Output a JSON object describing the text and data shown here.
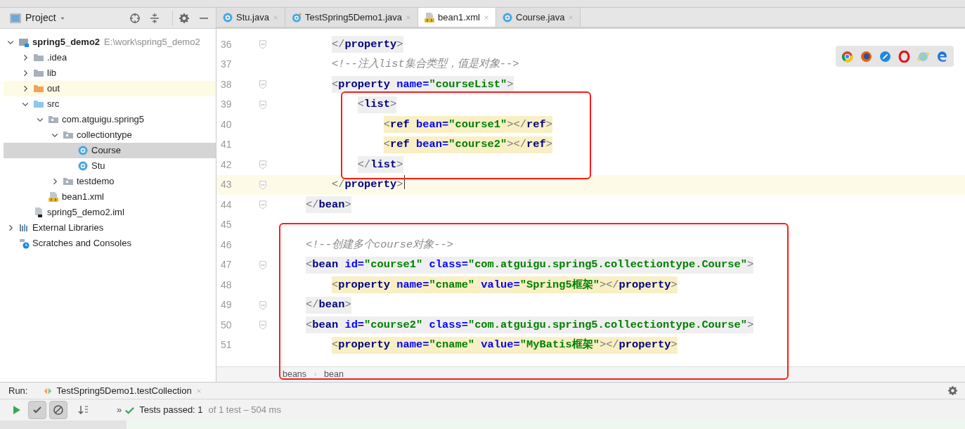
{
  "project_panel": {
    "title": "Project",
    "tree": [
      {
        "label": "spring5_demo2",
        "path": "E:\\work\\spring5_demo2",
        "kind": "module",
        "expanded": true,
        "selected": false,
        "highlighted": false,
        "children": [
          {
            "label": ".idea",
            "kind": "folder",
            "expanded": false,
            "selected": false,
            "highlighted": false
          },
          {
            "label": "lib",
            "kind": "folder",
            "expanded": false,
            "selected": false,
            "highlighted": false
          },
          {
            "label": "out",
            "kind": "excluded",
            "expanded": false,
            "selected": false,
            "highlighted": true
          },
          {
            "label": "src",
            "kind": "source",
            "expanded": true,
            "selected": false,
            "highlighted": false,
            "children": [
              {
                "label": "com.atguigu.spring5",
                "kind": "package",
                "expanded": true,
                "selected": false,
                "highlighted": false,
                "children": [
                  {
                    "label": "collectiontype",
                    "kind": "package",
                    "expanded": true,
                    "selected": false,
                    "highlighted": false,
                    "children": [
                      {
                        "label": "Course",
                        "kind": "class",
                        "selected": true,
                        "highlighted": false
                      },
                      {
                        "label": "Stu",
                        "kind": "class",
                        "selected": false,
                        "highlighted": false
                      }
                    ]
                  },
                  {
                    "label": "testdemo",
                    "kind": "package",
                    "expanded": false,
                    "selected": false,
                    "highlighted": false
                  }
                ]
              },
              {
                "label": "bean1.xml",
                "kind": "xml",
                "selected": false,
                "highlighted": false
              }
            ]
          },
          {
            "label": "spring5_demo2.iml",
            "kind": "iml",
            "selected": false,
            "highlighted": false
          }
        ]
      },
      {
        "label": "External Libraries",
        "kind": "libraries",
        "expanded": false,
        "selected": false,
        "highlighted": false
      },
      {
        "label": "Scratches and Consoles",
        "kind": "scratches",
        "selected": false,
        "highlighted": false
      }
    ]
  },
  "tabs": [
    {
      "label": "Stu.java",
      "kind": "class",
      "selected": false
    },
    {
      "label": "TestSpring5Demo1.java",
      "kind": "test",
      "selected": false
    },
    {
      "label": "bean1.xml",
      "kind": "xml",
      "selected": true
    },
    {
      "label": "Course.java",
      "kind": "class",
      "selected": false
    }
  ],
  "editor": {
    "lines": [
      {
        "number": "36",
        "fold": true,
        "current": false,
        "color": "#efefef",
        "tokens": [
          {
            "text": "        </",
            "kind": "bracket"
          },
          {
            "text": "property",
            "kind": "tag"
          },
          {
            "text": ">",
            "kind": "bracket"
          }
        ]
      },
      {
        "number": "37",
        "fold": false,
        "current": false,
        "tokens": [
          {
            "text": "        <!--注入list集合类型，值是对象-->",
            "kind": "comment"
          }
        ]
      },
      {
        "number": "38",
        "fold": true,
        "current": false,
        "color": "#efefef",
        "tokens": [
          {
            "text": "        <",
            "kind": "bracket"
          },
          {
            "text": "property ",
            "kind": "tag"
          },
          {
            "text": "name=",
            "kind": "attr"
          },
          {
            "text": "\"courseList\"",
            "kind": "value"
          },
          {
            "text": ">",
            "kind": "bracket"
          }
        ]
      },
      {
        "number": "39",
        "fold": true,
        "current": false,
        "color": "#efefef",
        "tokens": [
          {
            "text": "            <",
            "kind": "bracket"
          },
          {
            "text": "list",
            "kind": "tag"
          },
          {
            "text": ">",
            "kind": "bracket"
          }
        ]
      },
      {
        "number": "40",
        "fold": false,
        "current": false,
        "color": "#f8efc4",
        "tokens": [
          {
            "text": "                <",
            "kind": "bracket"
          },
          {
            "text": "ref ",
            "kind": "tag"
          },
          {
            "text": "bean=",
            "kind": "attr"
          },
          {
            "text": "\"course1\"",
            "kind": "value"
          },
          {
            "text": "></",
            "kind": "bracket"
          },
          {
            "text": "ref",
            "kind": "tag"
          },
          {
            "text": ">",
            "kind": "bracket"
          }
        ]
      },
      {
        "number": "41",
        "fold": false,
        "current": false,
        "color": "#f8efc4",
        "tokens": [
          {
            "text": "                <",
            "kind": "bracket"
          },
          {
            "text": "ref ",
            "kind": "tag"
          },
          {
            "text": "bean=",
            "kind": "attr"
          },
          {
            "text": "\"course2\"",
            "kind": "value"
          },
          {
            "text": "></",
            "kind": "bracket"
          },
          {
            "text": "ref",
            "kind": "tag"
          },
          {
            "text": ">",
            "kind": "bracket"
          }
        ]
      },
      {
        "number": "42",
        "fold": true,
        "current": false,
        "color": "#efefef",
        "tokens": [
          {
            "text": "            </",
            "kind": "bracket"
          },
          {
            "text": "list",
            "kind": "tag"
          },
          {
            "text": ">",
            "kind": "bracket"
          }
        ]
      },
      {
        "number": "43",
        "fold": true,
        "current": true,
        "tokens": [
          {
            "text": "        </",
            "kind": "bracket"
          },
          {
            "text": "property",
            "kind": "tag"
          },
          {
            "text": ">",
            "kind": "bracket"
          }
        ]
      },
      {
        "number": "44",
        "fold": true,
        "current": false,
        "color": "#efefef",
        "tokens": [
          {
            "text": "    </",
            "kind": "bracket"
          },
          {
            "text": "bean",
            "kind": "tag"
          },
          {
            "text": ">",
            "kind": "bracket"
          }
        ]
      },
      {
        "number": "45",
        "fold": false,
        "current": false
      },
      {
        "number": "46",
        "fold": false,
        "current": false,
        "tokens": [
          {
            "text": "    <!--创建多个course对象-->",
            "kind": "comment"
          }
        ]
      },
      {
        "number": "47",
        "fold": true,
        "current": false,
        "color": "#efefef",
        "tokens": [
          {
            "text": "    <",
            "kind": "bracket"
          },
          {
            "text": "bean ",
            "kind": "tag"
          },
          {
            "text": "id=",
            "kind": "attr"
          },
          {
            "text": "\"course1\" ",
            "kind": "value"
          },
          {
            "text": "class=",
            "kind": "attr"
          },
          {
            "text": "\"com.atguigu.spring5.collectiontype.Course\"",
            "kind": "value"
          },
          {
            "text": ">",
            "kind": "bracket"
          }
        ]
      },
      {
        "number": "48",
        "fold": false,
        "current": false,
        "color": "#f8efc4",
        "tokens": [
          {
            "text": "        <",
            "kind": "bracket"
          },
          {
            "text": "property ",
            "kind": "tag"
          },
          {
            "text": "name=",
            "kind": "attr"
          },
          {
            "text": "\"cname\" ",
            "kind": "value"
          },
          {
            "text": "value=",
            "kind": "attr"
          },
          {
            "text": "\"Spring5框架\"",
            "kind": "value"
          },
          {
            "text": "></",
            "kind": "bracket"
          },
          {
            "text": "property",
            "kind": "tag"
          },
          {
            "text": ">",
            "kind": "bracket"
          }
        ]
      },
      {
        "number": "49",
        "fold": true,
        "current": false,
        "color": "#efefef",
        "tokens": [
          {
            "text": "    </",
            "kind": "bracket"
          },
          {
            "text": "bean",
            "kind": "tag"
          },
          {
            "text": ">",
            "kind": "bracket"
          }
        ]
      },
      {
        "number": "50",
        "fold": true,
        "current": false,
        "color": "#efefef",
        "tokens": [
          {
            "text": "    <",
            "kind": "bracket"
          },
          {
            "text": "bean ",
            "kind": "tag"
          },
          {
            "text": "id=",
            "kind": "attr"
          },
          {
            "text": "\"course2\" ",
            "kind": "value"
          },
          {
            "text": "class=",
            "kind": "attr"
          },
          {
            "text": "\"com.atguigu.spring5.collectiontype.Course\"",
            "kind": "value"
          },
          {
            "text": ">",
            "kind": "bracket"
          }
        ]
      },
      {
        "number": "51",
        "fold": false,
        "current": false,
        "color": "#f8efc4",
        "tokens": [
          {
            "text": "        <",
            "kind": "bracket"
          },
          {
            "text": "property ",
            "kind": "tag"
          },
          {
            "text": "name=",
            "kind": "attr"
          },
          {
            "text": "\"cname\" ",
            "kind": "value"
          },
          {
            "text": "value=",
            "kind": "attr"
          },
          {
            "text": "\"MyBatis框架\"",
            "kind": "value"
          },
          {
            "text": "></",
            "kind": "bracket"
          },
          {
            "text": "property",
            "kind": "tag"
          },
          {
            "text": ">",
            "kind": "bracket"
          }
        ]
      }
    ],
    "breadcrumbs": [
      "beans",
      "bean"
    ]
  },
  "run_panel": {
    "label": "Run:",
    "tab": "TestSpring5Demo1.testCollection",
    "toolbar": [
      {
        "kind": "run",
        "selected": false
      },
      {
        "kind": "passed",
        "selected": true
      },
      {
        "kind": "ignored",
        "selected": true
      },
      {
        "kind": "sort",
        "selected": false
      }
    ],
    "more": "»",
    "status": "Tests passed: 1",
    "detail": "of 1 test – 504 ms"
  }
}
